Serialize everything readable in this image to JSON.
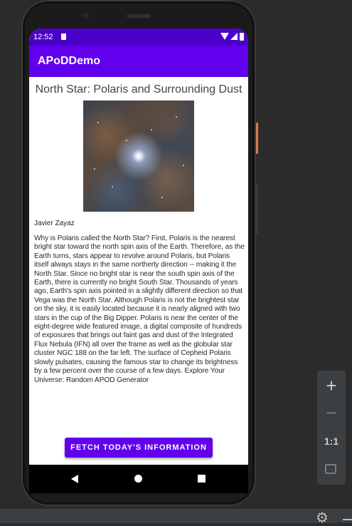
{
  "status_bar": {
    "time": "12:52"
  },
  "app_bar": {
    "title": "APoDDemo"
  },
  "apod": {
    "title": "North Star: Polaris and Surrounding Dust",
    "copyright": "Javier Zayaz",
    "explanation": "Why is Polaris called the North Star? First, Polaris is the nearest bright star toward the north spin axis of the Earth. Therefore, as the Earth turns, stars appear to revolve around Polaris, but Polaris itself always stays in the same northerly direction -- making it the North Star.  Since no bright star is near the south spin axis of the Earth, there is currently no bright South Star.  Thousands of years ago, Earth's spin axis pointed in a slightly different direction so that Vega was the North Star.  Although Polaris is not the brightest star on the sky, it is easily located because it is nearly aligned with two stars in the cup of the Big Dipper.  Polaris is near the center of the eight-degree wide featured image, a digital composite of hundreds of exposures that brings out faint gas and dust of the Integrated Flux Nebula (IFN) all over the frame as well as the globular star cluster NGC 188 on the far left.  The surface of Cepheid Polaris slowly pulsates, causing the famous star to change its brightness by a few percent over the course of a few days.   Explore Your Universe: Random APOD Generator"
  },
  "actions": {
    "fetch_label": "FETCH TODAY'S INFORMATION"
  },
  "emulator_toolbar": {
    "zoom_in": "+",
    "zoom_out": "−",
    "one_to_one": "1:1",
    "icons": [
      "plus-icon",
      "minus-icon",
      "one-to-one-icon",
      "fit-screen-icon",
      "gear-icon"
    ]
  },
  "colors": {
    "primary": "#6200ee",
    "status_bar": "#4b00c8"
  }
}
